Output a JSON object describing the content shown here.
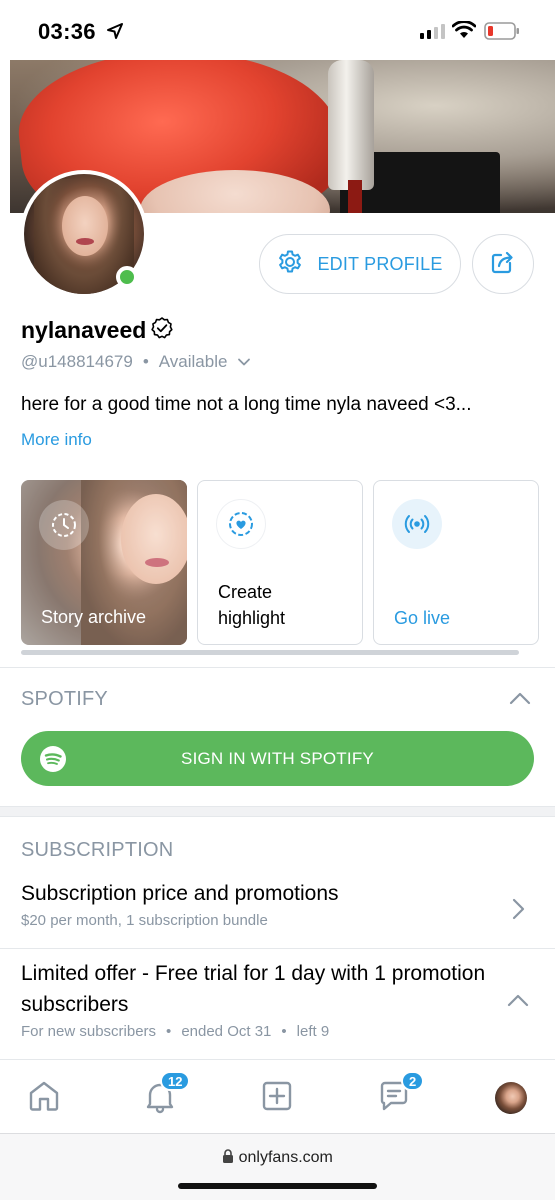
{
  "status_bar": {
    "time": "03:36"
  },
  "profile": {
    "edit_label": "EDIT PROFILE",
    "name": "nylanaveed",
    "handle": "@u148814679",
    "availability": "Available",
    "bio": "here for a good time not a long time nyla naveed <3...",
    "more_info": "More info"
  },
  "cards": [
    {
      "label": "Story archive"
    },
    {
      "label": "Create highlight"
    },
    {
      "label": "Go live"
    }
  ],
  "spotify": {
    "title": "SPOTIFY",
    "button_label": "SIGN IN WITH SPOTIFY",
    "brand_color": "#5cb85c"
  },
  "subscription": {
    "title": "SUBSCRIPTION",
    "price_title": "Subscription price and promotions",
    "price_desc": "$20 per month, 1 subscription bundle",
    "offer_title": "Limited offer - Free trial for 1 day with 1 promotion subscribers",
    "offer_audience": "For new subscribers",
    "offer_end": "ended Oct 31",
    "offer_left": "left 9"
  },
  "nav": {
    "notifications_badge": "12",
    "messages_badge": "2"
  },
  "browser": {
    "url": "onlyfans.com"
  },
  "colors": {
    "accent": "#2a9be0",
    "muted": "#8a96a3",
    "online": "#4ebd4d"
  }
}
